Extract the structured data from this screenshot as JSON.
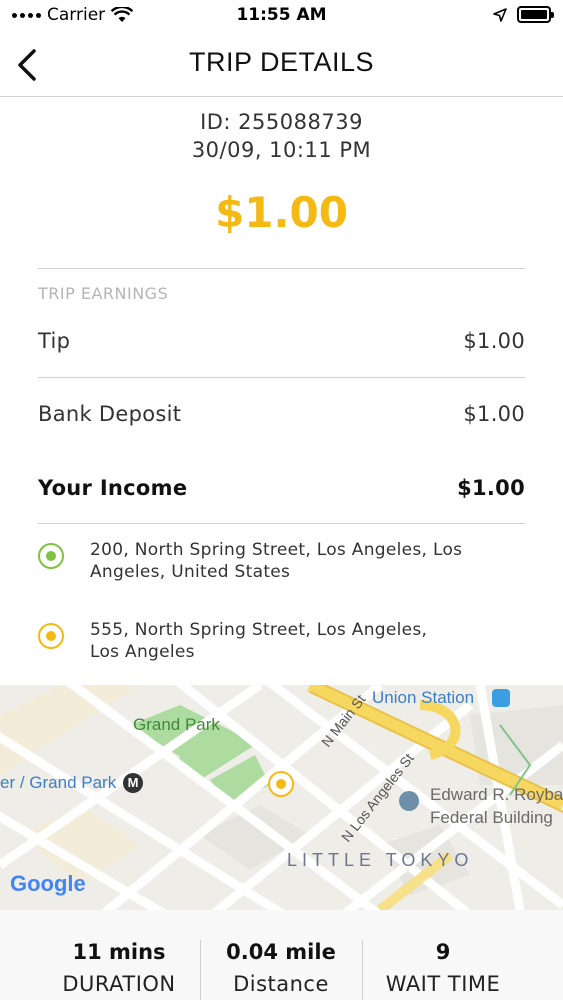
{
  "status_bar": {
    "carrier": "Carrier",
    "time": "11:55 AM"
  },
  "nav": {
    "title": "TRIP DETAILS",
    "back_icon": "chevron-left-icon"
  },
  "trip": {
    "id": "ID: 255088739",
    "datetime": "30/09, 10:11 PM",
    "total": "$1.00"
  },
  "earnings": {
    "section_label": "TRIP EARNINGS",
    "rows": [
      {
        "label": "Tip",
        "value": "$1.00"
      },
      {
        "label": "Bank Deposit",
        "value": "$1.00"
      },
      {
        "label": "Your Income",
        "value": "$1.00"
      }
    ]
  },
  "route": {
    "pickup_line1": "200, North Spring Street, Los Angeles, Los",
    "pickup_line2": "Angeles, United States",
    "dropoff_line1": "555, North Spring Street, Los Angeles,",
    "dropoff_line2": "Los Angeles"
  },
  "map": {
    "labels": {
      "union_station": "Union Station",
      "grand_park": "Grand Park",
      "metro": "er / Grand Park",
      "metro_badge": "M",
      "n_main": "N Main St",
      "n_los_angeles": "N Los Angeles St",
      "edward_line1": "Edward R. Roybal",
      "edward_line2": "Federal Building",
      "little_tokyo": "LITTLE TOKYO",
      "google": "Google"
    }
  },
  "stats": [
    {
      "value": "11 mins",
      "label": "DURATION"
    },
    {
      "value": "0.04 mile",
      "label": "Distance"
    },
    {
      "value": "9",
      "label": "WAIT TIME"
    }
  ],
  "colors": {
    "accent": "#f5b914",
    "pickup": "#7dc242"
  }
}
